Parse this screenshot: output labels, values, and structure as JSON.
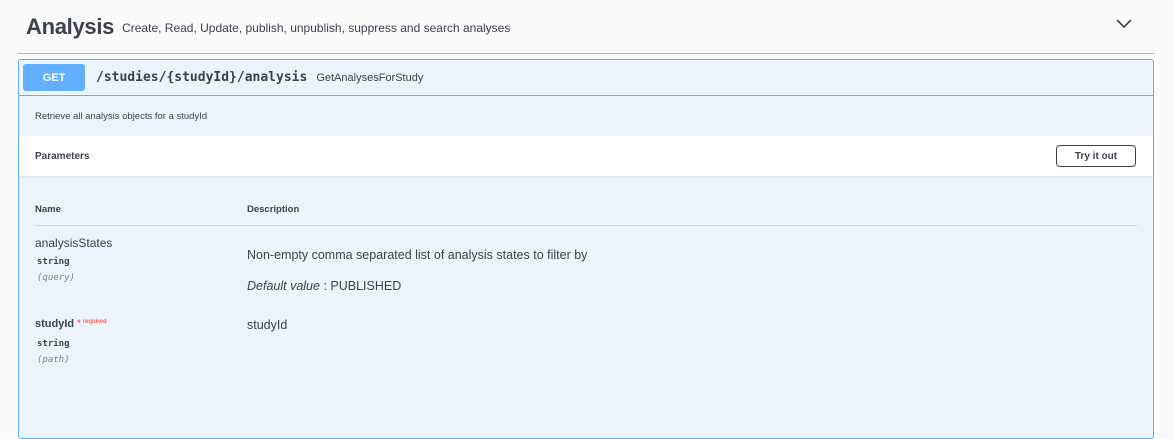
{
  "tag": {
    "title": "Analysis",
    "description": "Create, Read, Update, publish, unpublish, suppress and search analyses"
  },
  "operation": {
    "method": "GET",
    "path": "/studies/{studyId}/analysis",
    "operation_id": "GetAnalysesForStudy",
    "description": "Retrieve all analysis objects for a studyId"
  },
  "parameters": {
    "title": "Parameters",
    "try_label": "Try it out",
    "columns": {
      "name": "Name",
      "description": "Description"
    },
    "items": [
      {
        "name": "analysisStates",
        "type": "string",
        "in": "(query)",
        "description": "Non-empty comma separated list of analysis states to filter by",
        "default_label": "Default value",
        "default_sep": " : ",
        "default_value": "PUBLISHED"
      },
      {
        "name": "studyId",
        "required_star": "*",
        "required_label": "required",
        "type": "string",
        "in": "(path)",
        "description": "studyId"
      }
    ]
  },
  "colors": {
    "get_accent": "#61affe",
    "block_bg": "#ebf3fb",
    "text": "#3b4151",
    "required": "#ff6060"
  },
  "icons": {
    "collapse": "chevron-down-icon"
  }
}
